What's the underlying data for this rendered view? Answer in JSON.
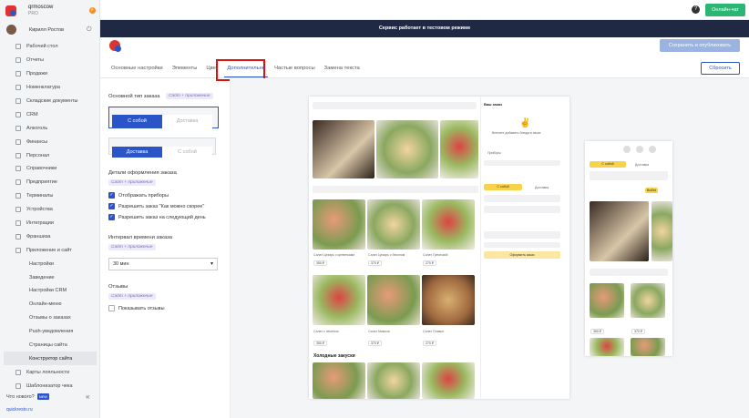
{
  "brand": {
    "name": "qrmoscow",
    "plan": "PRO"
  },
  "user": {
    "name": "Кирилл Ростов"
  },
  "sidebar": {
    "items": [
      {
        "label": "Рабочий стол"
      },
      {
        "label": "Отчеты"
      },
      {
        "label": "Продажи"
      },
      {
        "label": "Номенклатура"
      },
      {
        "label": "Складские документы"
      },
      {
        "label": "CRM"
      },
      {
        "label": "Алкоголь"
      },
      {
        "label": "Финансы"
      },
      {
        "label": "Персонал"
      },
      {
        "label": "Справочники"
      },
      {
        "label": "Предприятие"
      },
      {
        "label": "Терминалы"
      },
      {
        "label": "Устройства"
      },
      {
        "label": "Интеграции"
      },
      {
        "label": "Франшиза"
      },
      {
        "label": "Приложение и сайт"
      }
    ],
    "subitems": [
      {
        "label": "Настройки"
      },
      {
        "label": "Заведение"
      },
      {
        "label": "Настройки CRM"
      },
      {
        "label": "Онлайн-меню"
      },
      {
        "label": "Отзывы о заказах"
      },
      {
        "label": "Push-уведомления"
      },
      {
        "label": "Страницы сайта"
      },
      {
        "label": "Конструктор сайта"
      }
    ],
    "after": [
      {
        "label": "Карты лояльности"
      },
      {
        "label": "Шаблонизатор чека"
      }
    ],
    "whats_new": "Что нового?",
    "new_badge": "NEW",
    "collapse_icon": "«",
    "footer_link": "quickresto.ru"
  },
  "topbar": {
    "help": "?",
    "online_button": "Онлайн-чат"
  },
  "banner": "Сервис работает в тестовом режиме",
  "header": {
    "save_button": "Сохранить и опубликовать",
    "reset_button": "Сбросить"
  },
  "tabs": [
    {
      "label": "Основные настройки"
    },
    {
      "label": "Элементы"
    },
    {
      "label": "Цвет"
    },
    {
      "label": "Дополнительно"
    },
    {
      "label": "Частые вопросы"
    },
    {
      "label": "Замена текста"
    }
  ],
  "settings": {
    "order_type": {
      "title": "Основной тип заказа",
      "tag": "Сайт + приложение",
      "opt1": "С собой",
      "opt2": "Доставка"
    },
    "order_type2": {
      "opt1": "Доставка",
      "opt2": "С собой"
    },
    "details": {
      "title": "Детали оформления заказа",
      "tag": "Сайт + приложение",
      "checks": [
        "Отображать приборы",
        "Разрешить заказ \"Как можно скорее\"",
        "Разрешить заказ на следующий день"
      ]
    },
    "interval": {
      "title": "Интервал времени заказа",
      "tag": "Сайт + приложение",
      "value": "30 мин"
    },
    "reviews": {
      "title": "Отзывы",
      "tag": "Сайт + приложение",
      "check": "Показывать отзывы"
    }
  },
  "preview": {
    "cart_title": "Ваш заказ",
    "cart_empty": "Внесите добавить блюда в заказ",
    "devices": "Приборы",
    "section": "Холодные закуски",
    "dish1": "Салат Цезарь с креветками",
    "dish2": "Салат Цезарь с беконом",
    "dish3": "Салат Греческий",
    "dish4": "Салат с печенью",
    "dish5": "Салат Оливье",
    "dish6": "Салат Мимоза",
    "price1": "350 ₽",
    "price2": "370 ₽",
    "price3": "270 ₽",
    "tab_pickup": "С собой",
    "tab_delivery": "Доставка",
    "cta": "Оформить заказ",
    "mob_button": "Выйти"
  }
}
